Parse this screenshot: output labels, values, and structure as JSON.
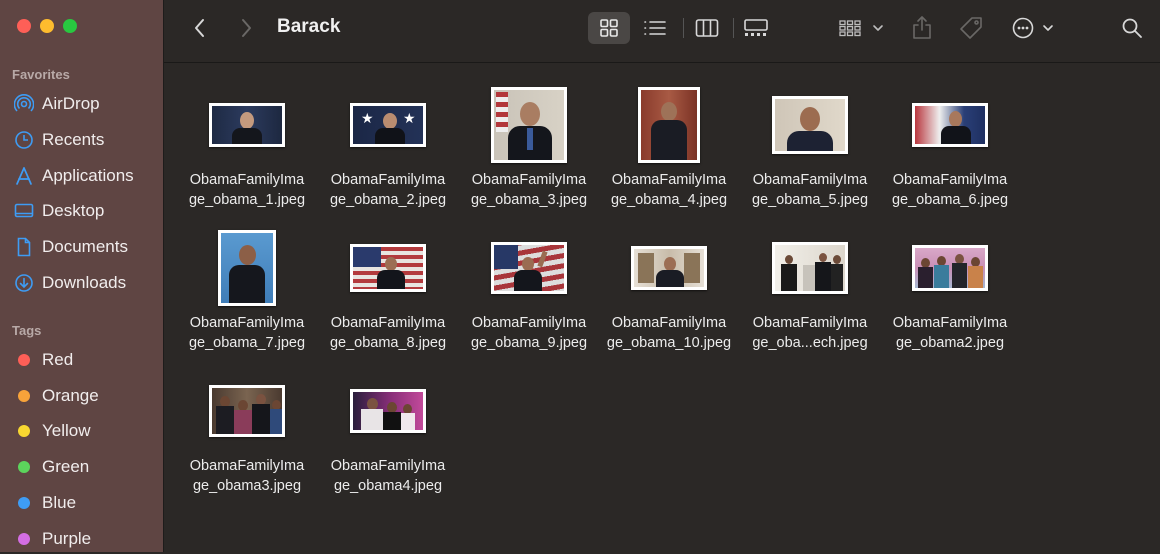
{
  "window": {
    "title": "Barack"
  },
  "sidebar": {
    "favorites_heading": "Favorites",
    "favorites": [
      {
        "label": "AirDrop",
        "icon": "airdrop-icon"
      },
      {
        "label": "Recents",
        "icon": "clock-icon"
      },
      {
        "label": "Applications",
        "icon": "applications-icon"
      },
      {
        "label": "Desktop",
        "icon": "desktop-icon"
      },
      {
        "label": "Documents",
        "icon": "document-icon"
      },
      {
        "label": "Downloads",
        "icon": "download-icon"
      }
    ],
    "tags_heading": "Tags",
    "tags": [
      {
        "label": "Red",
        "color": "#fe5f57"
      },
      {
        "label": "Orange",
        "color": "#f8a33a"
      },
      {
        "label": "Yellow",
        "color": "#f7d731"
      },
      {
        "label": "Green",
        "color": "#5cd45c"
      },
      {
        "label": "Blue",
        "color": "#3e9cf4"
      },
      {
        "label": "Purple",
        "color": "#d46ee4"
      }
    ]
  },
  "toolbar": {
    "back_icon": "chevron-left-icon",
    "forward_icon": "chevron-right-icon",
    "views": [
      "icon-view-icon",
      "list-view-icon",
      "column-view-icon",
      "gallery-view-icon"
    ],
    "group_icon": "group-icon",
    "share_icon": "share-icon",
    "tag_icon": "tag-icon",
    "more_icon": "ellipsis-icon",
    "search_icon": "search-icon",
    "accent": "#3e9cf4"
  },
  "files": [
    {
      "line1": "ObamaFamilyIma",
      "line2": "ge_obama_1.jpeg"
    },
    {
      "line1": "ObamaFamilyIma",
      "line2": "ge_obama_2.jpeg"
    },
    {
      "line1": "ObamaFamilyIma",
      "line2": "ge_obama_3.jpeg"
    },
    {
      "line1": "ObamaFamilyIma",
      "line2": "ge_obama_4.jpeg"
    },
    {
      "line1": "ObamaFamilyIma",
      "line2": "ge_obama_5.jpeg"
    },
    {
      "line1": "ObamaFamilyIma",
      "line2": "ge_obama_6.jpeg"
    },
    {
      "line1": "ObamaFamilyIma",
      "line2": "ge_obama_7.jpeg"
    },
    {
      "line1": "ObamaFamilyIma",
      "line2": "ge_obama_8.jpeg"
    },
    {
      "line1": "ObamaFamilyIma",
      "line2": "ge_obama_9.jpeg"
    },
    {
      "line1": "ObamaFamilyIma",
      "line2": "ge_obama_10.jpeg"
    },
    {
      "line1": "ObamaFamilyIma",
      "line2": "ge_oba...ech.jpeg"
    },
    {
      "line1": "ObamaFamilyIma",
      "line2": "ge_obama2.jpeg"
    },
    {
      "line1": "ObamaFamilyIma",
      "line2": "ge_obama3.jpeg"
    },
    {
      "line1": "ObamaFamilyIma",
      "line2": "ge_obama4.jpeg"
    }
  ]
}
